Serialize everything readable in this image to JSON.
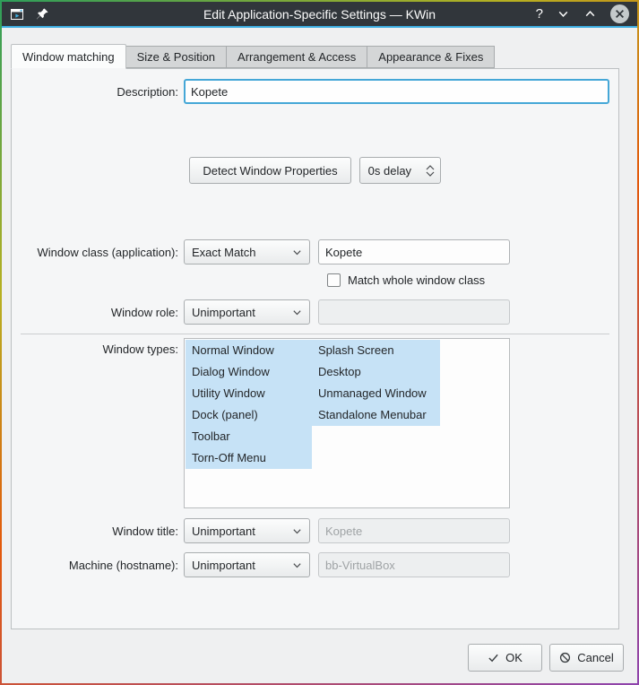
{
  "window": {
    "title": "Edit Application-Specific Settings — KWin",
    "titlebar": {
      "help_glyph": "?",
      "icons": [
        "window-rules-app-icon",
        "pin-icon",
        "help-icon",
        "minimize-icon",
        "maximize-icon",
        "close-icon"
      ]
    }
  },
  "tabs": {
    "items": [
      "Window matching",
      "Size & Position",
      "Arrangement & Access",
      "Appearance & Fixes"
    ],
    "active": "Window matching"
  },
  "description": {
    "label": "Description:",
    "value": "Kopete"
  },
  "detect": {
    "button_label": "Detect Window Properties",
    "delay_value": "0s delay"
  },
  "window_class": {
    "label": "Window class (application):",
    "match_mode": "Exact Match",
    "value": "Kopete",
    "checkbox_label": "Match whole window class",
    "checkbox_checked": false
  },
  "window_role": {
    "label": "Window role:",
    "match_mode": "Unimportant",
    "value": ""
  },
  "window_types": {
    "label": "Window types:",
    "col1": [
      "Normal Window",
      "Dialog Window",
      "Utility Window",
      "Dock (panel)",
      "Toolbar",
      "Torn-Off Menu"
    ],
    "col2": [
      "Splash Screen",
      "Desktop",
      "Unmanaged Window",
      "Standalone Menubar"
    ],
    "all_selected": true
  },
  "window_title": {
    "label": "Window title:",
    "match_mode": "Unimportant",
    "value": "Kopete",
    "disabled": true
  },
  "machine": {
    "label": "Machine (hostname):",
    "match_mode": "Unimportant",
    "value": "bb-VirtualBox",
    "disabled": true
  },
  "footer": {
    "ok_label": "OK",
    "cancel_label": "Cancel"
  },
  "colors": {
    "titlebar": "#31363b",
    "accent": "#3daee2",
    "winbg": "#eff0f1",
    "selection": "#c6e2f6",
    "text": "#232629"
  }
}
